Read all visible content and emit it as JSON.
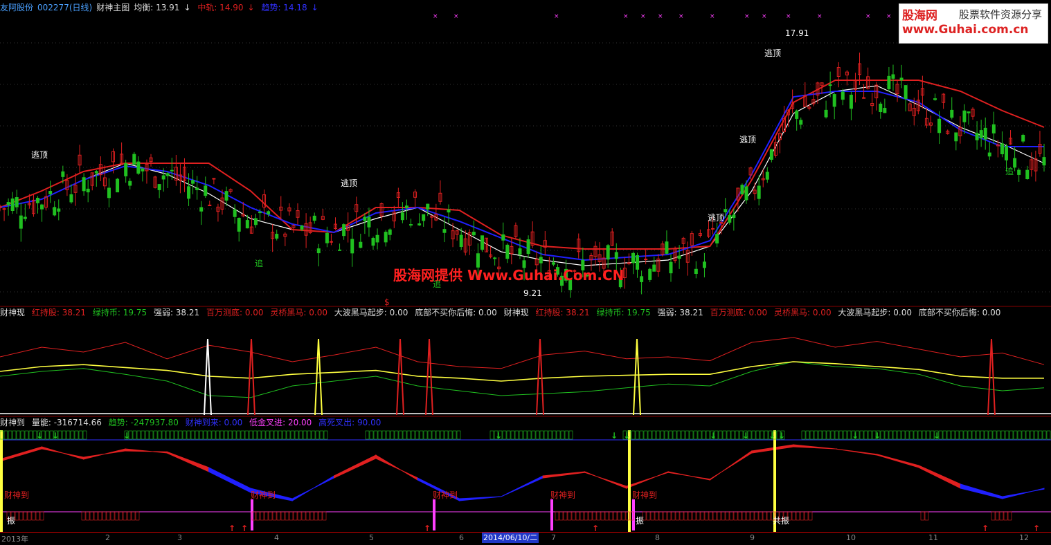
{
  "header": {
    "stock_name": "友阿股份",
    "stock_code": "002277(日线)",
    "indicator": "财神主图",
    "balance_label": "均衡: 13.91",
    "mid_label": "中轨: 14.90",
    "trend_label": "趋势: 14.18"
  },
  "mid_header": {
    "title": "财神现",
    "red_stock": "红持股: 38.21",
    "green_coin": "绿持币: 19.75",
    "strength": "强弱: 38.21",
    "million_bottom": "百万测底: 0.00",
    "lingqiao": "灵桥黑马: 0.00",
    "big_wave": "大波黑马起步: 0.00",
    "regret": "底部不买你后悔: 0.00",
    "title2": "财神现",
    "red_stock2": "红持股: 38.21",
    "green_coin2": "绿持币: 19.75",
    "strength2": "强弱: 38.21",
    "million_bottom2": "百万测底: 0.00",
    "lingqiao2": "灵桥黑马: 0.00",
    "big_wave2": "大波黑马起步: 0.00",
    "regret2": "底部不买你后悔: 0.00"
  },
  "low_header": {
    "title": "财神到",
    "volume_energy": "量能: -316714.66",
    "trend": "趋势: -247937.80",
    "arrive": "财神到来: 0.00",
    "low_cross": "低金叉进: 20.00",
    "high_cross": "高死叉出: 90.00"
  },
  "watermark": {
    "logo_cn": "股海网",
    "logo_tag": "股票软件资源分享",
    "logo_url": "www.Guhai.com.cn",
    "center": "股海网提供 Www.Guhai.Com.CN"
  },
  "annotations": {
    "escape_top": "逃顶",
    "chase": "追",
    "high_price": "17.91",
    "low_price": "9.21",
    "caishen_dao": "财神到",
    "zhen": "振",
    "gong_zhen": "共振",
    "dollar": "$"
  },
  "xaxis": {
    "labels": [
      "2013年",
      "2",
      "3",
      "4",
      "5",
      "6",
      "7",
      "8",
      "9",
      "10",
      "11",
      "12"
    ],
    "cursor_date": "2014/06/10/二"
  },
  "colors": {
    "up": "#e02020",
    "down": "#20c020",
    "balance": "#ffffff",
    "mid": "#e02020",
    "trend": "#2020ff",
    "yellow": "#ffff40",
    "magenta": "#ff40ff"
  },
  "chart_data": [
    {
      "type": "line",
      "title": "财神主图",
      "series": [
        {
          "name": "均衡",
          "values": [
            12.0,
            12.3,
            13.0,
            13.6,
            13.2,
            12.5,
            11.6,
            11.2,
            11.1,
            11.6,
            12.0,
            11.2,
            10.4,
            10.1,
            9.9,
            10.0,
            10.1,
            10.6,
            12.6,
            15.4,
            16.2,
            16.4,
            15.7,
            14.9,
            14.3,
            13.6
          ]
        },
        {
          "name": "中轨",
          "values": [
            12.0,
            12.6,
            13.3,
            13.6,
            13.6,
            13.6,
            12.6,
            11.2,
            11.1,
            12.0,
            12.0,
            11.9,
            11.0,
            10.6,
            10.5,
            10.5,
            10.5,
            10.6,
            13.0,
            15.8,
            16.6,
            16.6,
            16.6,
            16.2,
            15.5,
            14.9
          ]
        },
        {
          "name": "趋势",
          "values": [
            12.0,
            12.3,
            13.0,
            13.5,
            13.3,
            12.8,
            12.0,
            11.4,
            11.1,
            11.8,
            12.0,
            11.5,
            10.9,
            10.3,
            10.1,
            10.2,
            10.3,
            10.8,
            13.2,
            16.0,
            16.2,
            16.2,
            15.8,
            14.8,
            14.2,
            14.2
          ]
        }
      ],
      "high_label": 17.91,
      "low_label": 9.21
    },
    {
      "type": "line",
      "title": "财神现",
      "series": [
        {
          "name": "红持股",
          "values": [
            60,
            70,
            65,
            75,
            58,
            72,
            65,
            55,
            62,
            70,
            55,
            50,
            48,
            62,
            66,
            58,
            60,
            56,
            75,
            80,
            70,
            76,
            68,
            60,
            64,
            52
          ]
        },
        {
          "name": "绿持币",
          "values": [
            40,
            45,
            48,
            42,
            35,
            20,
            18,
            30,
            35,
            40,
            30,
            25,
            20,
            22,
            24,
            28,
            32,
            30,
            45,
            55,
            50,
            48,
            42,
            30,
            25,
            28
          ]
        },
        {
          "name": "强弱",
          "values": [
            45,
            50,
            52,
            49,
            46,
            40,
            38,
            42,
            44,
            46,
            40,
            38,
            35,
            38,
            40,
            41,
            42,
            42,
            50,
            55,
            53,
            50,
            47,
            40,
            38,
            38
          ]
        }
      ]
    },
    {
      "type": "area",
      "title": "财神到",
      "series": [
        {
          "name": "量能",
          "values": [
            60,
            90,
            60,
            85,
            75,
            30,
            -20,
            -40,
            20,
            70,
            10,
            -40,
            -30,
            20,
            30,
            -10,
            30,
            10,
            80,
            95,
            85,
            70,
            40,
            -10,
            -35,
            -10
          ]
        },
        {
          "name": "趋势",
          "values": [
            55,
            85,
            65,
            80,
            78,
            40,
            -10,
            -35,
            15,
            62,
            15,
            -35,
            -30,
            15,
            28,
            -5,
            28,
            12,
            75,
            90,
            85,
            72,
            45,
            0,
            -30,
            -12
          ]
        }
      ]
    }
  ]
}
